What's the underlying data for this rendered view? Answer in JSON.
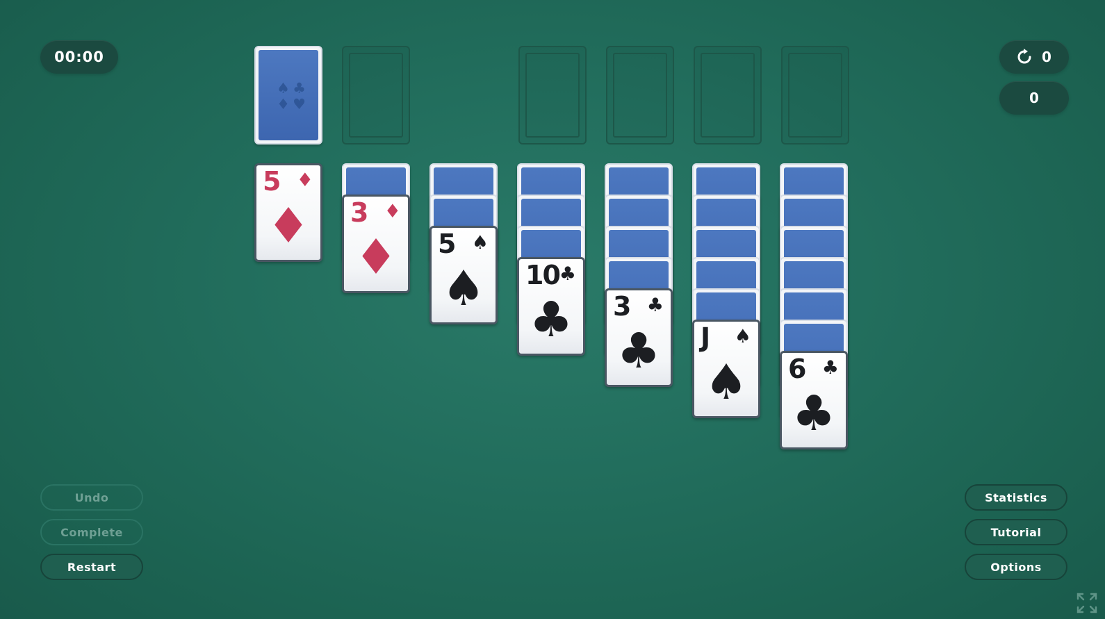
{
  "hud": {
    "timer": "00:00",
    "moves": "0",
    "score": "0"
  },
  "buttons": {
    "undo": "Undo",
    "complete": "Complete",
    "restart": "Restart",
    "statistics": "Statistics",
    "tutorial": "Tutorial",
    "options": "Options"
  },
  "stock": {
    "emblem": [
      "♠",
      "♣",
      "♦",
      "♥"
    ]
  },
  "tableau": [
    {
      "face_down": 0,
      "top": {
        "rank": "5",
        "suit": "♦",
        "suit_name": "diamonds"
      }
    },
    {
      "face_down": 1,
      "top": {
        "rank": "3",
        "suit": "♦",
        "suit_name": "diamonds"
      }
    },
    {
      "face_down": 2,
      "top": {
        "rank": "5",
        "suit": "♠",
        "suit_name": "spades"
      }
    },
    {
      "face_down": 3,
      "top": {
        "rank": "10",
        "suit": "♣",
        "suit_name": "clubs"
      }
    },
    {
      "face_down": 4,
      "top": {
        "rank": "3",
        "suit": "♣",
        "suit_name": "clubs"
      }
    },
    {
      "face_down": 5,
      "top": {
        "rank": "J",
        "suit": "♠",
        "suit_name": "spades"
      }
    },
    {
      "face_down": 6,
      "top": {
        "rank": "6",
        "suit": "♣",
        "suit_name": "clubs"
      }
    }
  ],
  "colors": {
    "felt": "#226e5d",
    "red_suit": "#c83c5c",
    "black_suit": "#1c1e22",
    "card_back": "#4570b8"
  },
  "icons": {
    "moves": "refresh-icon",
    "fullscreen": "expand-icon"
  }
}
